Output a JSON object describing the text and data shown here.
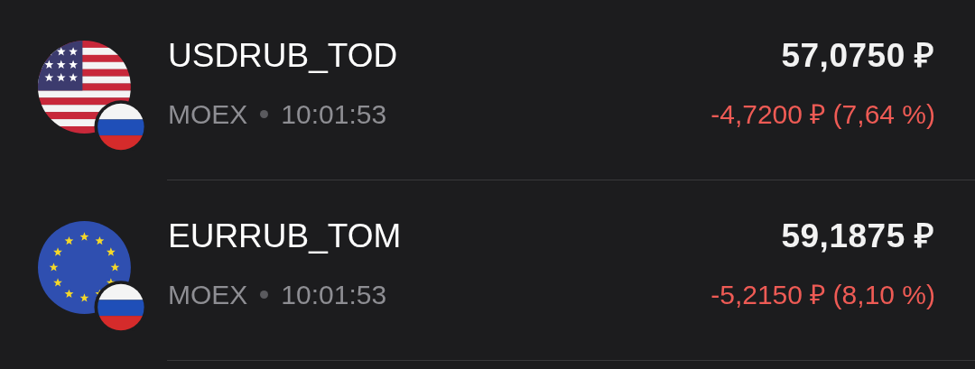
{
  "quotes": [
    {
      "ticker": "USDRUB_TOD",
      "exchange": "MOEX",
      "time": "10:01:53",
      "price": "57,0750 ₽",
      "change": "-4,7200 ₽ (7,64 %)"
    },
    {
      "ticker": "EURRUB_TOM",
      "exchange": "MOEX",
      "time": "10:01:53",
      "price": "59,1875 ₽",
      "change": "-5,2150 ₽ (8,10 %)"
    }
  ]
}
